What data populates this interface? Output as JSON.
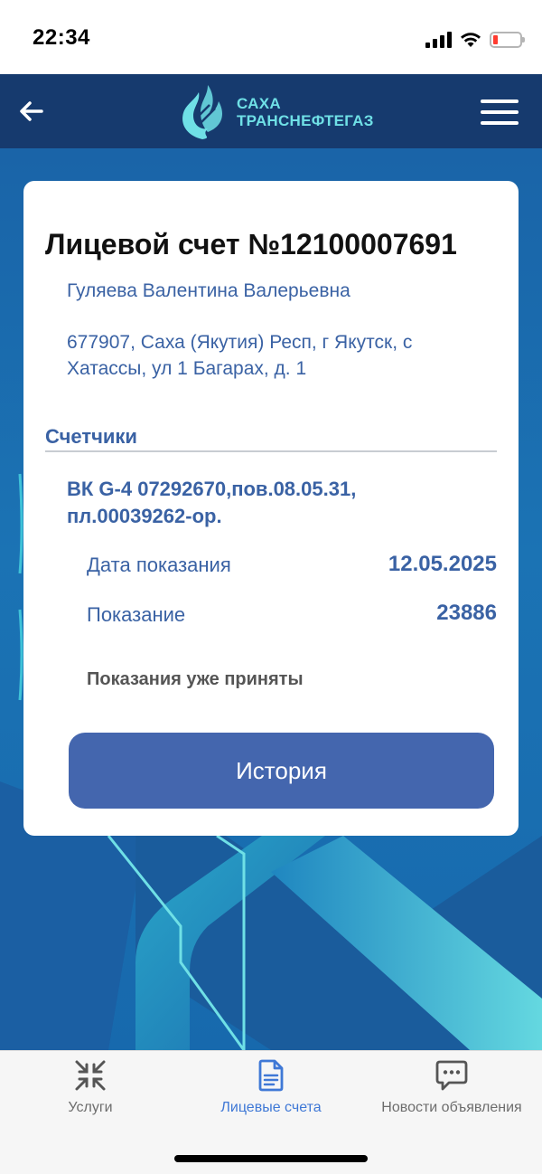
{
  "status_bar": {
    "time": "22:34"
  },
  "header": {
    "logo_line1": "САХА",
    "logo_line2": "ТРАНСНЕФТЕГАЗ"
  },
  "account": {
    "title": "Лицевой счет №12100007691",
    "owner": "Гуляева Валентина Валерьевна",
    "address": "677907, Саха (Якутия) Респ, г Якутск, с Хатассы, ул 1 Багарах, д. 1"
  },
  "meters": {
    "section_title": "Счетчики",
    "meter_name": "ВК G-4 07292670,пов.08.05.31, пл.00039262-ор.",
    "reading_date_label": "Дата показания",
    "reading_date_value": "12.05.2025",
    "reading_label": "Показание",
    "reading_value": "23886",
    "status_note": "Показания уже приняты"
  },
  "history_button": {
    "label": "История"
  },
  "bottom_nav": {
    "items": [
      {
        "label": "Услуги",
        "icon": "services-icon",
        "active": false
      },
      {
        "label": "Лицевые счета",
        "icon": "document-icon",
        "active": true
      },
      {
        "label": "Новости объявления",
        "icon": "chat-icon",
        "active": false
      }
    ]
  },
  "colors": {
    "header_bg": "#163a6e",
    "accent": "#3a62a4",
    "button": "#4466ae",
    "logo": "#6fe0e6",
    "nav_active": "#3f78d6"
  }
}
